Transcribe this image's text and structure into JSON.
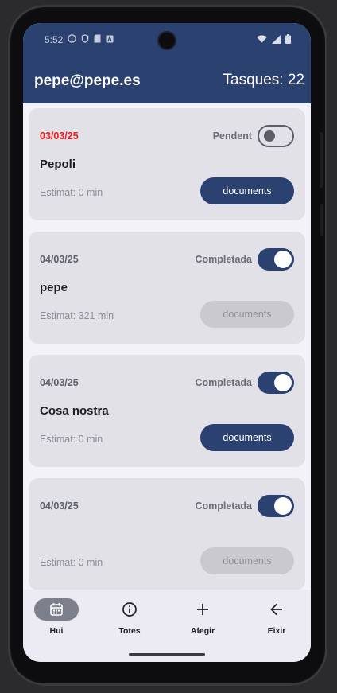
{
  "status_bar": {
    "time": "5:52",
    "left_icons": [
      "info-icon",
      "shield-icon",
      "sd-card-icon",
      "app-notification-icon"
    ],
    "right_icons": [
      "wifi-icon",
      "signal-icon",
      "battery-icon"
    ]
  },
  "app_bar": {
    "user": "pepe@pepe.es",
    "task_count": "Tasques: 22"
  },
  "tasks": [
    {
      "date": "03/03/25",
      "status": "Pendent",
      "title": "Pepoli",
      "estimate": "Estimat: 0 min",
      "documents_label": "documents",
      "completed": false,
      "overdue": true,
      "documents_enabled": true
    },
    {
      "date": "04/03/25",
      "status": "Completada",
      "title": "pepe",
      "estimate": "Estimat: 321 min",
      "documents_label": "documents",
      "completed": true,
      "overdue": false,
      "documents_enabled": false
    },
    {
      "date": "04/03/25",
      "status": "Completada",
      "title": "Cosa nostra",
      "estimate": "Estimat: 0 min",
      "documents_label": "documents",
      "completed": true,
      "overdue": false,
      "documents_enabled": true
    },
    {
      "date": "04/03/25",
      "status": "Completada",
      "title": "",
      "estimate": "Estimat: 0 min",
      "documents_label": "documents",
      "completed": true,
      "overdue": false,
      "documents_enabled": false
    }
  ],
  "bottom_nav": {
    "items": [
      {
        "label": "Hui",
        "icon": "calendar-icon",
        "selected": true
      },
      {
        "label": "Totes",
        "icon": "info-icon",
        "selected": false
      },
      {
        "label": "Afegir",
        "icon": "plus-icon",
        "selected": false
      },
      {
        "label": "Eixir",
        "icon": "arrow-left-icon",
        "selected": false
      }
    ]
  },
  "colors": {
    "primary": "#2b4170",
    "overdue_date": "#e8211f",
    "card_background": "#e1e1e7",
    "screen_background": "#f3f2f8"
  }
}
